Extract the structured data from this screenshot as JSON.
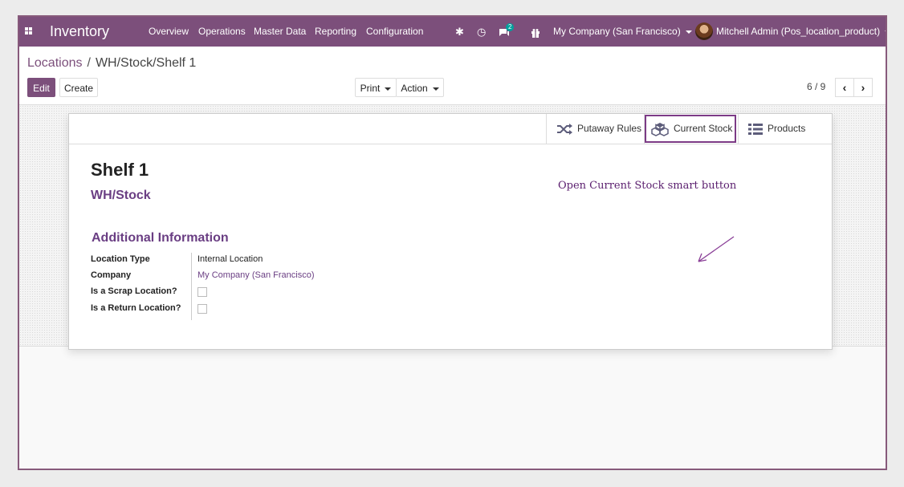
{
  "navbar": {
    "app_name": "Inventory",
    "menu": [
      "Overview",
      "Operations",
      "Master Data",
      "Reporting",
      "Configuration"
    ],
    "chat_badge": "2",
    "company": "My Company (San Francisco)",
    "user": "Mitchell Admin (Pos_location_product)",
    "accent_color": "#7c4f7b"
  },
  "breadcrumb": {
    "parent": "Locations",
    "separator": "/",
    "current": "WH/Stock/Shelf 1"
  },
  "toolbar": {
    "edit": "Edit",
    "create": "Create",
    "print": "Print",
    "action": "Action"
  },
  "pager": {
    "value": "6 / 9"
  },
  "smart_buttons": {
    "putaway": "Putaway Rules",
    "current_stock": "Current Stock",
    "products": "Products"
  },
  "record": {
    "name": "Shelf 1",
    "parent": "WH/Stock",
    "section_title": "Additional Information",
    "fields": {
      "location_type_label": "Location Type",
      "location_type_value": "Internal Location",
      "company_label": "Company",
      "company_value": "My Company (San Francisco)",
      "scrap_label": "Is a Scrap Location?",
      "scrap_checked": false,
      "return_label": "Is a Return Location?",
      "return_checked": false
    }
  },
  "annotation": {
    "text": "Open Current Stock smart button",
    "color": "#5a1e6e"
  }
}
